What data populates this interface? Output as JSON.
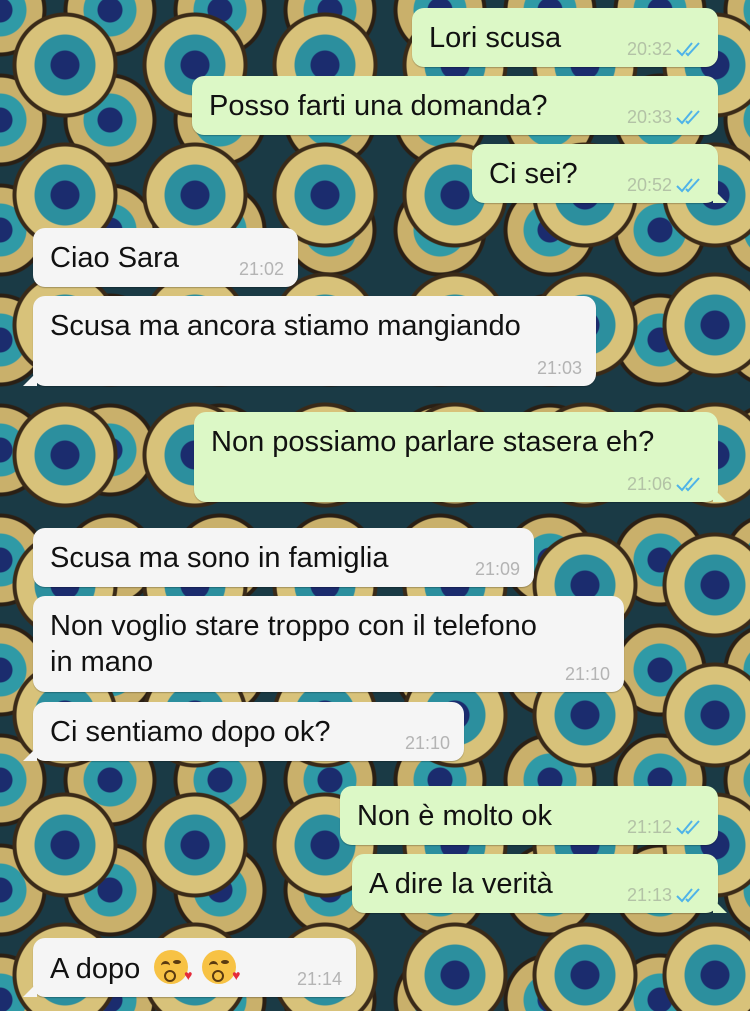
{
  "messages": [
    {
      "text": "Lori scusa",
      "time": "20:32",
      "dir": "out",
      "read": true
    },
    {
      "text": "Posso farti una domanda?",
      "time": "20:33",
      "dir": "out",
      "read": true
    },
    {
      "text": "Ci sei?",
      "time": "20:52",
      "dir": "out",
      "read": true
    },
    {
      "text": "Ciao Sara",
      "time": "21:02",
      "dir": "in"
    },
    {
      "text": "Scusa ma ancora stiamo mangiando",
      "time": "21:03",
      "dir": "in"
    },
    {
      "text": "Non possiamo parlare stasera eh?",
      "time": "21:06",
      "dir": "out",
      "read": true
    },
    {
      "text": "Scusa ma sono in famiglia",
      "time": "21:09",
      "dir": "in"
    },
    {
      "text": "Non voglio stare troppo con il telefono in mano",
      "time": "21:10",
      "dir": "in"
    },
    {
      "text": "Ci sentiamo dopo ok?",
      "time": "21:10",
      "dir": "in"
    },
    {
      "text": "Non è molto ok",
      "time": "21:12",
      "dir": "out",
      "read": true
    },
    {
      "text": "A dire la verità",
      "time": "21:13",
      "dir": "out",
      "read": true
    },
    {
      "text": "A dopo",
      "time": "21:14",
      "dir": "in",
      "emoji": [
        "kissing-heart-emoji",
        "kissing-heart-emoji"
      ]
    }
  ],
  "colors": {
    "outgoing_bubble": "#dcf8c6",
    "incoming_bubble": "#f5f5f5",
    "read_ticks": "#4fb3e8"
  },
  "icons": {
    "read_receipt": "double-check-icon"
  }
}
